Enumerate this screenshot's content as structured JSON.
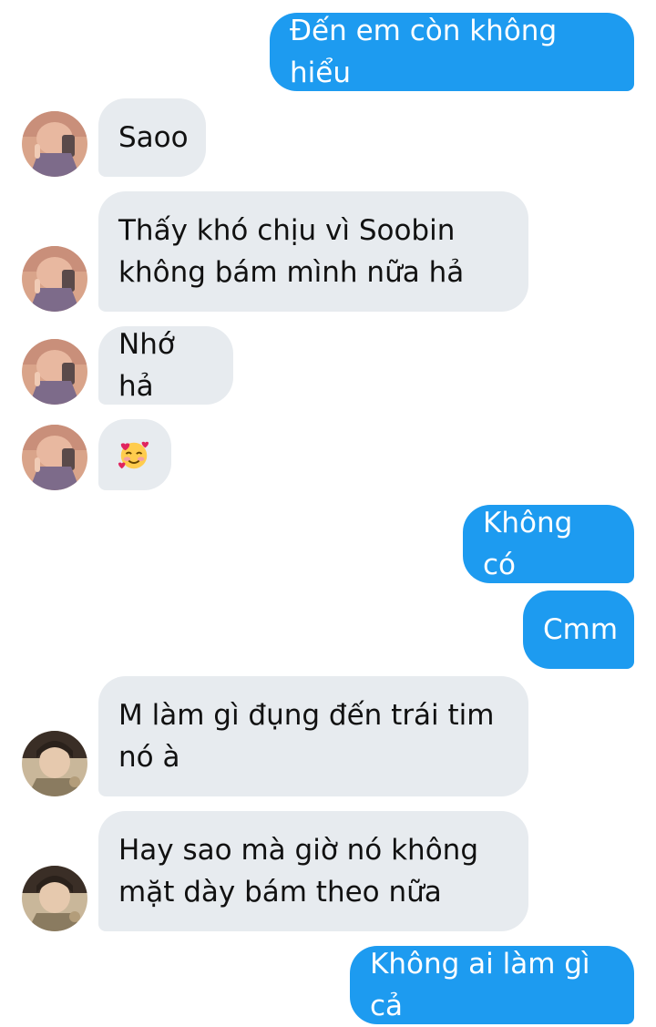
{
  "conversation": {
    "messages": [
      {
        "side": "sent",
        "text": "Đến em còn không hiểu"
      },
      {
        "side": "received",
        "text": "Saoo",
        "avatar": "avatar-a"
      },
      {
        "side": "received",
        "text": "Thấy khó chịu vì Soobin\nkhông bám mình nữa hả",
        "avatar": "avatar-a"
      },
      {
        "side": "received",
        "text": "Nhớ hả",
        "avatar": "avatar-a"
      },
      {
        "side": "received",
        "emoji": "smiling-face-with-hearts-icon",
        "avatar": "avatar-a"
      },
      {
        "side": "sent",
        "text": "Không có"
      },
      {
        "side": "sent",
        "text": "Cmm"
      },
      {
        "side": "received",
        "text": "M làm gì đụng đến trái tim\nnó à",
        "avatar": "avatar-b"
      },
      {
        "side": "received",
        "text": "Hay sao mà giờ nó không\nmặt dày bám theo nữa",
        "avatar": "avatar-b"
      },
      {
        "side": "sent",
        "text": "Không ai làm gì cả"
      }
    ]
  },
  "colors": {
    "sent_bubble": "#1d9bf0",
    "received_bubble": "#e7ebef",
    "background": "#ffffff"
  }
}
